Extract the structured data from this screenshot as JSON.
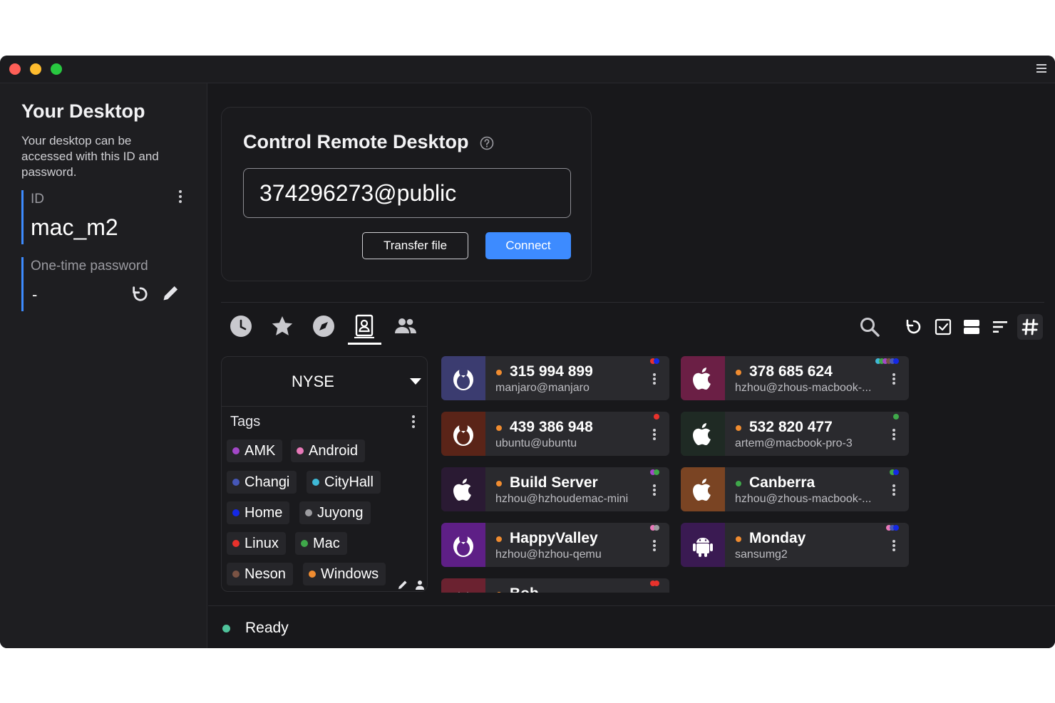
{
  "left_panel": {
    "title": "Your Desktop",
    "description": "Your desktop can be accessed with this ID and password.",
    "id_label": "ID",
    "id_value": "mac_m2",
    "password_label": "One-time password",
    "password_value": "-"
  },
  "control": {
    "title": "Control Remote Desktop",
    "input_value": "374296273@public",
    "transfer_label": "Transfer file",
    "connect_label": "Connect"
  },
  "toolbar": {
    "tabs": [
      "clock-icon",
      "star-icon",
      "compass-icon",
      "address-book-icon",
      "group-icon"
    ],
    "active_tab": "address-book-icon",
    "tools": [
      "search-icon",
      "refresh-icon",
      "checkbox-icon",
      "list-view-icon",
      "sort-icon",
      "hash-icon"
    ]
  },
  "address_book": {
    "selected": "NYSE",
    "tags_title": "Tags",
    "tags": [
      {
        "name": "AMK",
        "color": "#a347c8"
      },
      {
        "name": "Android",
        "color": "#e879b9"
      },
      {
        "name": "Changi",
        "color": "#4657b8"
      },
      {
        "name": "CityHall",
        "color": "#3fb9d6"
      },
      {
        "name": "Home",
        "color": "#1428e6"
      },
      {
        "name": "Juyong",
        "color": "#9c9ca0"
      },
      {
        "name": "Linux",
        "color": "#e8322c"
      },
      {
        "name": "Mac",
        "color": "#3fa84a"
      },
      {
        "name": "Neson",
        "color": "#7a5344"
      },
      {
        "name": "Windows",
        "color": "#f08c30"
      }
    ]
  },
  "peers": [
    {
      "name": "315 994 899",
      "sub": "manjaro@manjaro",
      "avatar_bg": "#3b3c70",
      "os": "linux-penguin-icon",
      "status": "#f08c30",
      "tags": [
        "#e8322c",
        "#1428e6"
      ]
    },
    {
      "name": "378 685 624",
      "sub": "hzhou@zhous-macbook-...",
      "avatar_bg": "#6b1f45",
      "os": "apple-icon",
      "status": "#f08c30",
      "tags": [
        "#3fb9d6",
        "#3fa84a",
        "#a347c8",
        "#7a5344",
        "#4657b8",
        "#1428e6"
      ]
    },
    {
      "name": "439 386 948",
      "sub": "ubuntu@ubuntu",
      "avatar_bg": "#5a2418",
      "os": "linux-penguin-icon",
      "status": "#f08c30",
      "tags": [
        "#e8322c"
      ]
    },
    {
      "name": "532 820 477",
      "sub": "artem@macbook-pro-3",
      "avatar_bg": "#1f2a24",
      "os": "apple-icon",
      "status": "#f08c30",
      "tags": [
        "#3fa84a"
      ]
    },
    {
      "name": "Build Server",
      "sub": "hzhou@hzhoudemac-mini",
      "avatar_bg": "#2a1a33",
      "os": "apple-icon",
      "status": "#f08c30",
      "tags": [
        "#a347c8",
        "#3fa84a"
      ]
    },
    {
      "name": "Canberra",
      "sub": "hzhou@zhous-macbook-...",
      "avatar_bg": "#7a4423",
      "os": "apple-icon",
      "status": "#3fa84a",
      "tags": [
        "#3fa84a",
        "#1428e6"
      ]
    },
    {
      "name": "HappyValley",
      "sub": "hzhou@hzhou-qemu",
      "avatar_bg": "#5e1f86",
      "os": "linux-penguin-icon",
      "status": "#f08c30",
      "tags": [
        "#e879b9",
        "#9c9ca0"
      ]
    },
    {
      "name": "Monday",
      "sub": "sansumg2",
      "avatar_bg": "#3a1a52",
      "os": "android-icon",
      "status": "#f08c30",
      "tags": [
        "#e879b9",
        "#4657b8",
        "#1428e6"
      ]
    },
    {
      "name": "Bob",
      "sub": "",
      "avatar_bg": "#6b2230",
      "os": "linux-penguin-icon",
      "status": "#f08c30",
      "tags": [
        "#e8322c",
        "#e8322c"
      ]
    }
  ],
  "status": {
    "text": "Ready",
    "color": "#4fc39b"
  }
}
